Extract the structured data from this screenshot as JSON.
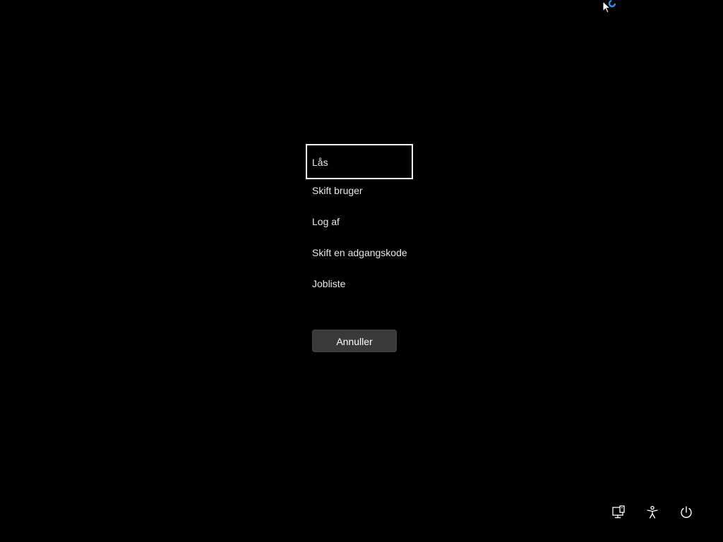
{
  "menu": {
    "items": [
      {
        "label": "Lås",
        "selected": true
      },
      {
        "label": "Skift bruger",
        "selected": false
      },
      {
        "label": "Log af",
        "selected": false
      },
      {
        "label": "Skift en adgangskode",
        "selected": false
      },
      {
        "label": "Jobliste",
        "selected": false
      }
    ]
  },
  "cancel": {
    "label": "Annuller"
  },
  "bottom_bar": {
    "icons": [
      "network-icon",
      "accessibility-icon",
      "power-icon"
    ]
  },
  "colors": {
    "background": "#000000",
    "text": "#e8e8e8",
    "button": "#3a3a3a",
    "focus_border": "#ffffff",
    "busy_indicator": "#2f8fe8"
  }
}
